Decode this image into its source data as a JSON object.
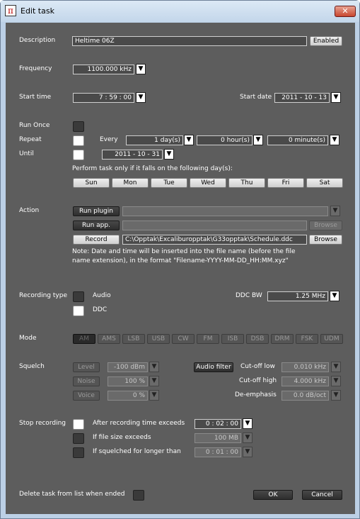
{
  "window": {
    "title": "Edit task",
    "close_glyph": "✕",
    "icon_glyph": "π"
  },
  "description": {
    "label": "Description",
    "value": "Heltime 06Z",
    "enabled_label": "Enabled"
  },
  "frequency": {
    "label": "Frequency",
    "value": "1100.000 kHz"
  },
  "start": {
    "time_label": "Start time",
    "time": "7 : 59 : 00",
    "date_label": "Start date",
    "date": "2011 - 10 - 13"
  },
  "repeat": {
    "run_once": "Run Once",
    "repeat": "Repeat",
    "until": "Until",
    "every": "Every",
    "days": "1 day(s)",
    "hours": "0 hour(s)",
    "minutes": "0 minute(s)",
    "until_date": "2011 - 10 - 31",
    "days_hint": "Perform task only if it falls on the following day(s):",
    "days_of_week": [
      "Sun",
      "Mon",
      "Tue",
      "Wed",
      "Thu",
      "Fri",
      "Sat"
    ]
  },
  "action": {
    "label": "Action",
    "run_plugin": "Run plugin",
    "run_app": "Run app.",
    "record": "Record",
    "browse": "Browse",
    "record_path": "C:\\Opptak\\Excaliburopptak\\G33opptak\\Schedule.ddc",
    "note": "Note: Date and time will be inserted into the file name (before the file name extension), in the format \"Filename-YYYY-MM-DD_HH:MM.xyz\""
  },
  "recording": {
    "label": "Recording type",
    "audio": "Audio",
    "ddc": "DDC",
    "ddc_bw_label": "DDC BW",
    "ddc_bw": "1.25 MHz"
  },
  "mode": {
    "label": "Mode",
    "modes": [
      "AM",
      "AMS",
      "LSB",
      "USB",
      "CW",
      "FM",
      "ISB",
      "DSB",
      "DRM",
      "FSK",
      "UDM"
    ]
  },
  "squelch": {
    "label": "Squelch",
    "level": "Level",
    "level_value": "-100 dBm",
    "noise": "Noise",
    "noise_value": "100 %",
    "voice": "Voice",
    "voice_value": "0 %",
    "audio_filter": "Audio filter",
    "cutoff_low_label": "Cut-off low",
    "cutoff_low": "0.010 kHz",
    "cutoff_high_label": "Cut-off high",
    "cutoff_high": "4.000 kHz",
    "deemph_label": "De-emphasis",
    "deemph": "0.0 dB/oct"
  },
  "stop": {
    "label": "Stop recording",
    "after_time": "After recording time exceeds",
    "after_time_value": "0 : 02 : 00",
    "file_size": "If file size exceeds",
    "file_size_value": "100 MB",
    "squelched": "If squelched for longer than",
    "squelched_value": "0 : 01 : 00"
  },
  "footer": {
    "delete_label": "Delete task from list when ended",
    "ok": "OK",
    "cancel": "Cancel"
  },
  "icons": {
    "dropdown": "▼"
  }
}
